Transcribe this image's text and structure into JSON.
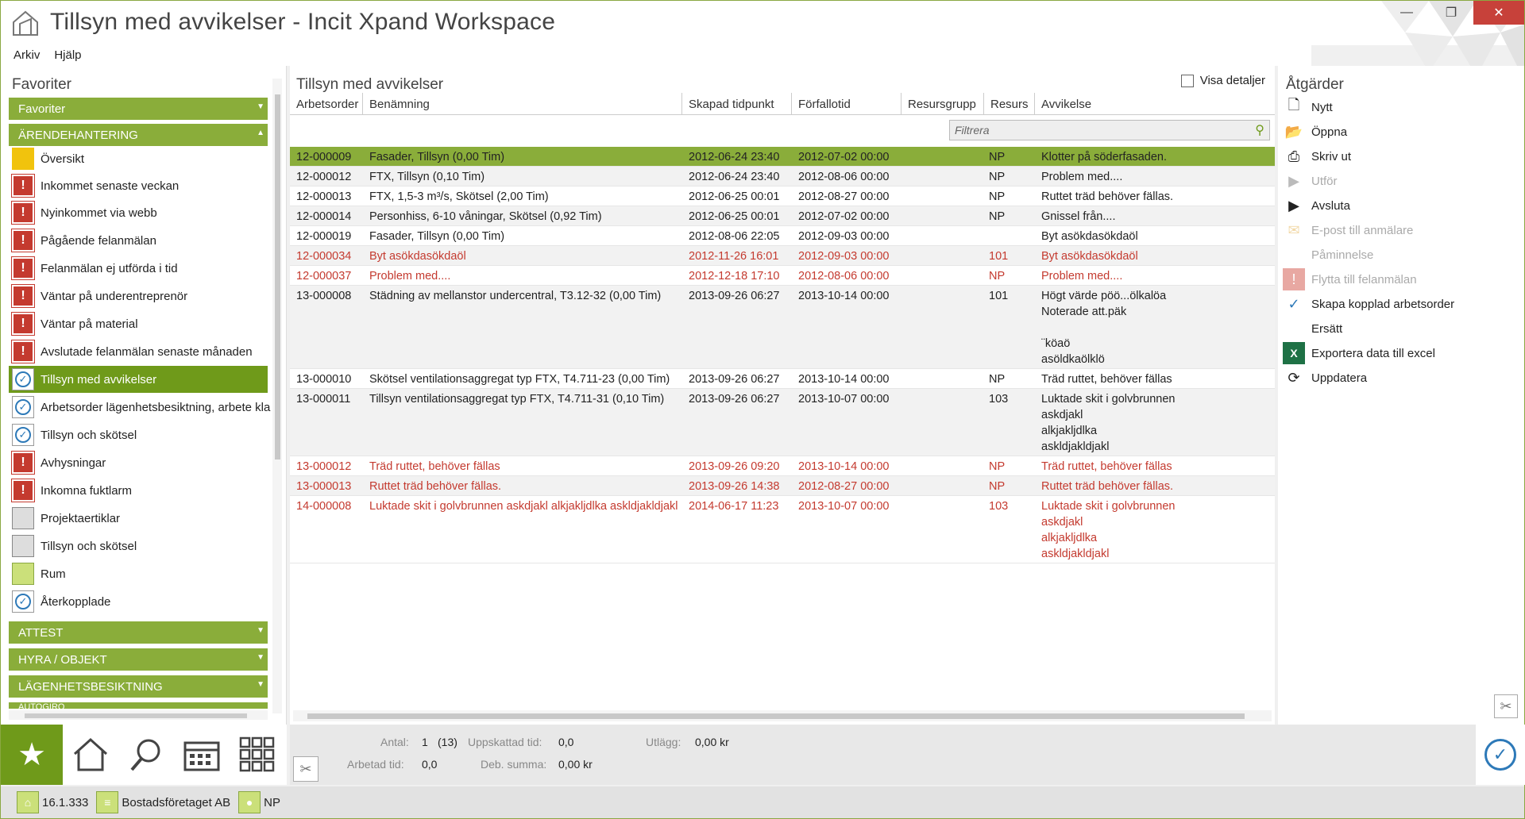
{
  "window": {
    "title": "Tillsyn med avvikelser - Incit Xpand Workspace",
    "minimize": "—",
    "maximize": "❐",
    "close": "✕"
  },
  "menu": [
    "Arkiv",
    "Hjälp"
  ],
  "favorites_panel": {
    "header": "Favoriter",
    "groups": {
      "favoriter": "Favoriter",
      "arende": "ÄRENDEHANTERING",
      "attest": "ATTEST",
      "hyra": "HYRA / OBJEKT",
      "lagenhet": "LÄGENHETSBESIKTNING",
      "autogiro": "AUTOGIRO"
    },
    "items": [
      {
        "label": "Översikt",
        "icon": "overview-icon"
      },
      {
        "label": "Inkommet senaste veckan",
        "icon": "alert-icon"
      },
      {
        "label": "Nyinkommet via webb",
        "icon": "alert-icon"
      },
      {
        "label": "Pågående felanmälan",
        "icon": "alert-icon"
      },
      {
        "label": "Felanmälan ej utförda i tid",
        "icon": "alert-icon"
      },
      {
        "label": "Väntar på underentreprenör",
        "icon": "alert-icon"
      },
      {
        "label": "Väntar på material",
        "icon": "alert-icon"
      },
      {
        "label": "Avslutade felanmälan senaste månaden",
        "icon": "alert-icon"
      },
      {
        "label": "Tillsyn med avvikelser",
        "icon": "check-icon"
      },
      {
        "label": "Arbetsorder lägenhetsbesiktning, arbete kla",
        "icon": "check-icon"
      },
      {
        "label": "Tillsyn och skötsel",
        "icon": "check-icon"
      },
      {
        "label": "Avhysningar",
        "icon": "alert-icon"
      },
      {
        "label": "Inkomna fuktlarm",
        "icon": "alert-icon"
      },
      {
        "label": "Projektaertiklar",
        "icon": "table-icon"
      },
      {
        "label": "Tillsyn och skötsel",
        "icon": "document-icon"
      },
      {
        "label": "Rum",
        "icon": "room-icon"
      },
      {
        "label": "Återkopplade",
        "icon": "check-icon"
      }
    ]
  },
  "list": {
    "header": "Tillsyn med avvikelser",
    "show_details": "Visa detaljer",
    "columns": [
      "Arbetsorder",
      "Benämning",
      "Skapad tidpunkt",
      "Förfallotid",
      "Resursgrupp",
      "Resurs",
      "Avvikelse"
    ],
    "filter_placeholder": "Filtrera",
    "rows": [
      {
        "order": "12-000009",
        "name": "Fasader, Tillsyn (0,00 Tim)",
        "created": "2012-06-24 23:40",
        "due": "2012-07-02 00:00",
        "group": "",
        "resource": "NP",
        "deviation": "Klotter på söderfasaden."
      },
      {
        "order": "12-000012",
        "name": "FTX, Tillsyn (0,10 Tim)",
        "created": "2012-06-24 23:40",
        "due": "2012-08-06 00:00",
        "group": "",
        "resource": "NP",
        "deviation": "Problem med...."
      },
      {
        "order": "12-000013",
        "name": "FTX, 1,5-3 m³/s, Skötsel (2,00 Tim)",
        "created": "2012-06-25 00:01",
        "due": "2012-08-27 00:00",
        "group": "",
        "resource": "NP",
        "deviation": "Ruttet träd behöver fällas."
      },
      {
        "order": "12-000014",
        "name": "Personhiss, 6-10 våningar, Skötsel (0,92 Tim)",
        "created": "2012-06-25 00:01",
        "due": "2012-07-02 00:00",
        "group": "",
        "resource": "NP",
        "deviation": "Gnissel från...."
      },
      {
        "order": "12-000019",
        "name": "Fasader, Tillsyn (0,00 Tim)",
        "created": "2012-08-06 22:05",
        "due": "2012-09-03 00:00",
        "group": "",
        "resource": "",
        "deviation": "Byt asökdasökdaöl"
      },
      {
        "order": "12-000034",
        "name": "Byt asökdasökdaöl",
        "created": "2012-11-26 16:01",
        "due": "2012-09-03 00:00",
        "group": "",
        "resource": "101",
        "deviation": "Byt asökdasökdaöl"
      },
      {
        "order": "12-000037",
        "name": "Problem med....",
        "created": "2012-12-18 17:10",
        "due": "2012-08-06 00:00",
        "group": "",
        "resource": "NP",
        "deviation": "Problem med...."
      },
      {
        "order": "13-000008",
        "name": "Städning av mellanstor undercentral, T3.12-32 (0,00 Tim)",
        "created": "2013-09-26 06:27",
        "due": "2013-10-14 00:00",
        "group": "",
        "resource": "101",
        "deviation": "Högt värde pöö...ölkalöa\nNoterade att.päk\n\n¨köaö\nasöldkaölklö"
      },
      {
        "order": "13-000010",
        "name": "Skötsel ventilationsaggregat typ FTX, T4.711-23 (0,00 Tim)",
        "created": "2013-09-26 06:27",
        "due": "2013-10-14 00:00",
        "group": "",
        "resource": "NP",
        "deviation": "Träd ruttet, behöver fällas"
      },
      {
        "order": "13-000011",
        "name": "Tillsyn ventilationsaggregat typ FTX, T4.711-31 (0,10 Tim)",
        "created": "2013-09-26 06:27",
        "due": "2013-10-07 00:00",
        "group": "",
        "resource": "103",
        "deviation": "Luktade skit i golvbrunnen\naskdjakl\nalkjakljdlka\naskldjakldjakl"
      },
      {
        "order": "13-000012",
        "name": "Träd ruttet, behöver fällas",
        "created": "2013-09-26 09:20",
        "due": "2013-10-14 00:00",
        "group": "",
        "resource": "NP",
        "deviation": "Träd ruttet, behöver fällas"
      },
      {
        "order": "13-000013",
        "name": "Ruttet träd behöver fällas.",
        "created": "2013-09-26 14:38",
        "due": "2012-08-27 00:00",
        "group": "",
        "resource": "NP",
        "deviation": "Ruttet träd behöver fällas."
      },
      {
        "order": "14-000008",
        "name": "Luktade skit i golvbrunnen askdjakl alkjakljdlka askldjakldjakl",
        "created": "2014-06-17 11:23",
        "due": "2013-10-07 00:00",
        "group": "",
        "resource": "103",
        "deviation": "Luktade skit i golvbrunnen\naskdjakl\nalkjakljdlka\naskldjakldjakl"
      }
    ]
  },
  "footer": {
    "antal_label": "Antal:",
    "antal_val": "1",
    "antal_total": "(13)",
    "uppskattad_label": "Uppskattad tid:",
    "uppskattad_val": "0,0",
    "utlagg_label": "Utlägg:",
    "utlagg_val": "0,00 kr",
    "arbetad_label": "Arbetad tid:",
    "arbetad_val": "0,0",
    "deb_label": "Deb. summa:",
    "deb_val": "0,00 kr"
  },
  "actions": {
    "header": "Åtgärder",
    "items": [
      {
        "label": "Nytt",
        "icon": "new-document-icon",
        "enabled": true
      },
      {
        "label": "Öppna",
        "icon": "folder-open-icon",
        "enabled": true
      },
      {
        "label": "Skriv ut",
        "icon": "printer-icon",
        "enabled": true
      },
      {
        "label": "Utför",
        "icon": "play-icon",
        "enabled": false
      },
      {
        "label": "Avsluta",
        "icon": "play-icon",
        "enabled": true
      },
      {
        "label": "E-post till anmälare",
        "icon": "email-icon",
        "enabled": false
      },
      {
        "label": "Påminnelse",
        "icon": "",
        "enabled": false
      },
      {
        "label": "Flytta till felanmälan",
        "icon": "alert-icon",
        "enabled": false
      },
      {
        "label": "Skapa kopplad arbetsorder",
        "icon": "check-icon",
        "enabled": true
      },
      {
        "label": "Ersätt",
        "icon": "",
        "enabled": true
      },
      {
        "label": "Exportera data till excel",
        "icon": "excel-icon",
        "enabled": true
      },
      {
        "label": "Uppdatera",
        "icon": "refresh-icon",
        "enabled": true
      }
    ]
  },
  "status": {
    "version": "16.1.333",
    "company": "Bostadsföretaget AB",
    "user": "NP"
  }
}
